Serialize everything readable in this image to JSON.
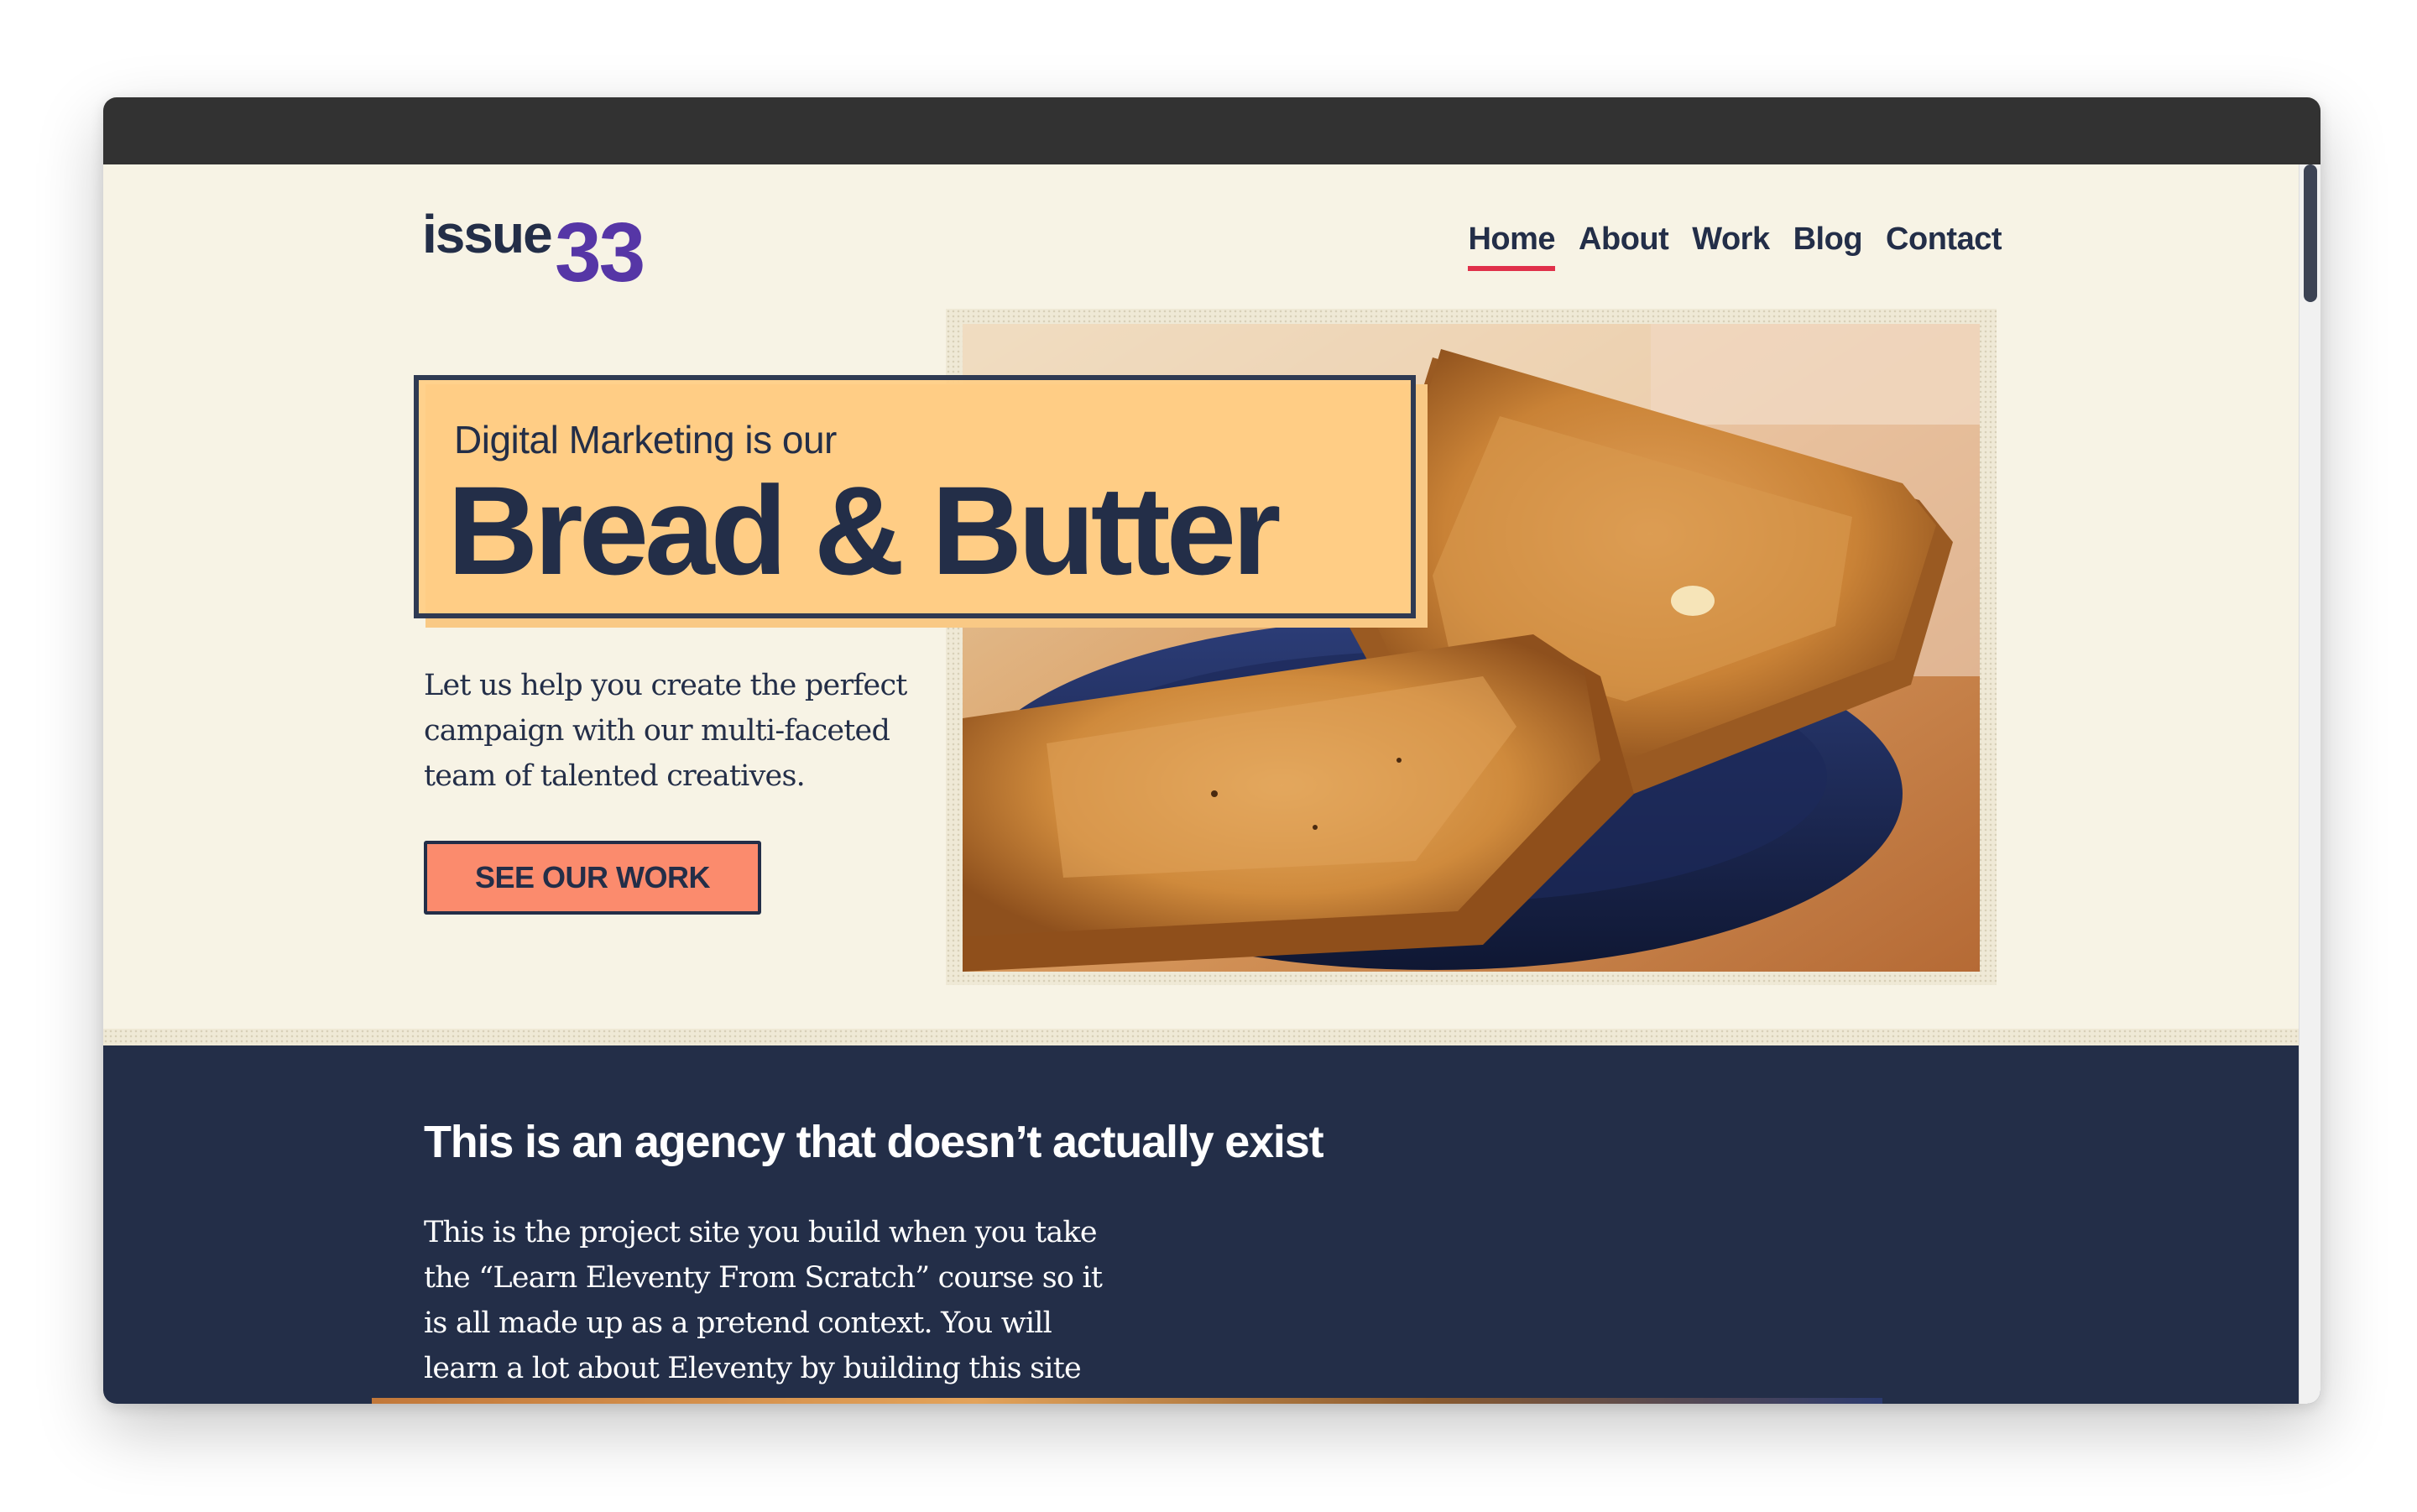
{
  "header": {
    "logo_word": "issue",
    "logo_number": "33",
    "nav": [
      {
        "label": "Home",
        "active": true
      },
      {
        "label": "About",
        "active": false
      },
      {
        "label": "Work",
        "active": false
      },
      {
        "label": "Blog",
        "active": false
      },
      {
        "label": "Contact",
        "active": false
      }
    ]
  },
  "hero": {
    "subtitle": "Digital Marketing is our",
    "title": "Bread & Butter",
    "text_lines": [
      "Let us help you create the perfect",
      "campaign with our multi-faceted",
      "team of talented creatives."
    ],
    "cta_label": "SEE OUR WORK"
  },
  "about": {
    "title": "This is an agency that doesn’t actually exist",
    "text_lines": [
      "This is the project site you build when you take",
      "the “Learn Eleventy From Scratch” course so it",
      "is all made up as a pretend context. You will",
      "learn a lot about Eleventy by building this site"
    ]
  },
  "colors": {
    "background": "#f7f3e5",
    "navy": "#232e48",
    "purple": "#5636a6",
    "accent_red": "#e0304a",
    "highlight": "#ffce85",
    "cta": "#fb8b6d"
  },
  "icons": [
    "toast-photo"
  ]
}
